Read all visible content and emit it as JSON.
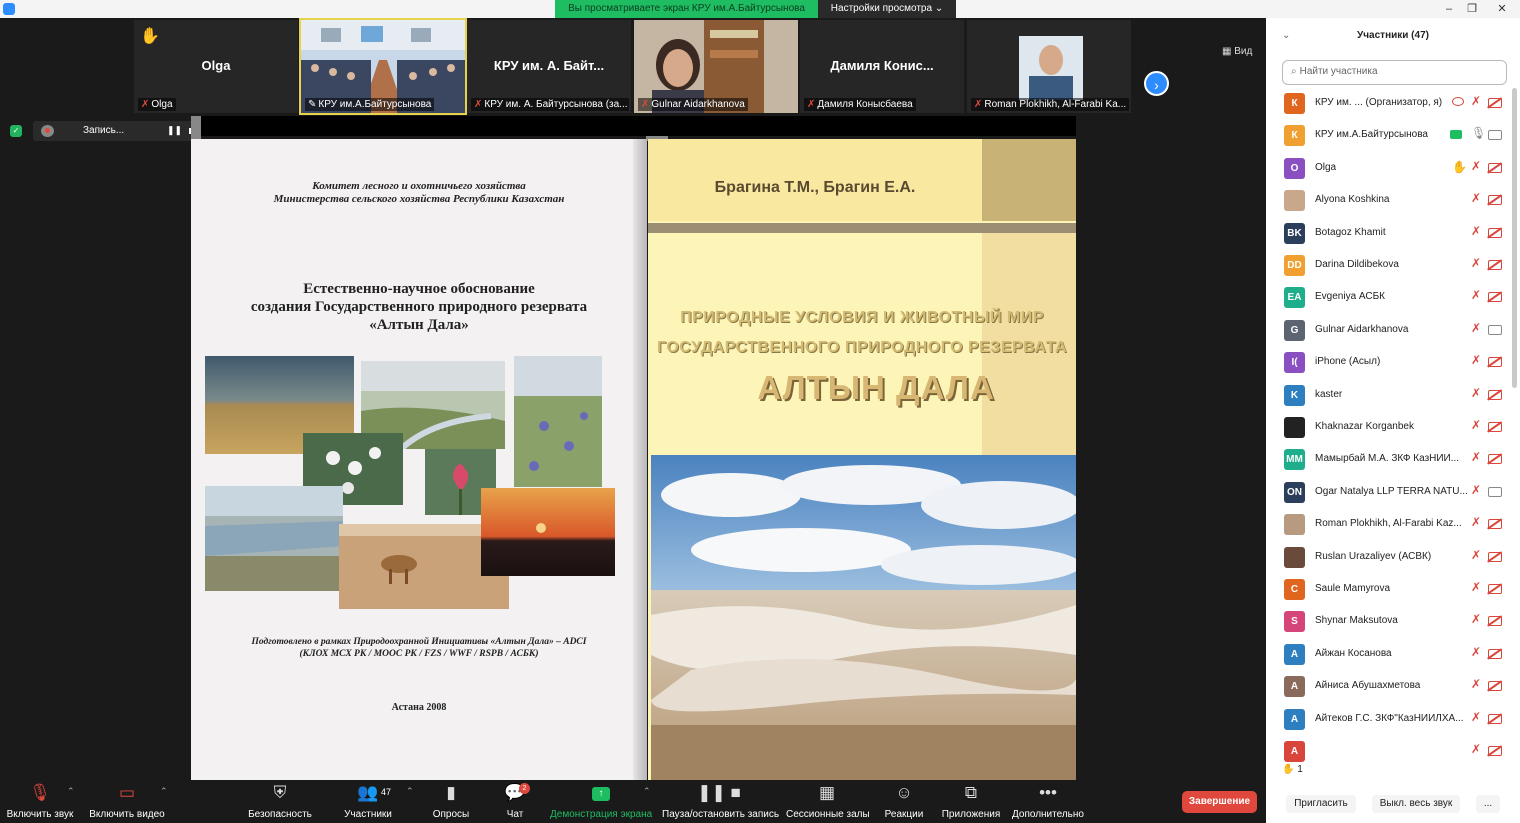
{
  "top_bar": {
    "share_banner": "Вы просматриваете экран КРУ им.А.Байтурсынова",
    "view_settings": "Настройки просмотра ⌄",
    "window_controls": {
      "minimize": "–",
      "restore": "❐",
      "close": "✕"
    }
  },
  "gallery": {
    "tiles": [
      {
        "name_center": "Olga",
        "label": "Olga",
        "icon": "hand-raised-icon"
      },
      {
        "name_center": "",
        "label": "КРУ им.А.Байтурсынова",
        "icon": "pin-icon"
      },
      {
        "name_center": "КРУ им. А. Байт...",
        "label": "КРУ им. А. Байтурсынова (за..."
      },
      {
        "name_center": "",
        "label": "Gulnar Aidarkhanova"
      },
      {
        "name_center": "Дамиля  Конис...",
        "label": "Дамиля Конысбаева"
      },
      {
        "name_center": "",
        "label": "Roman Plokhikh, Al-Farabi Ka..."
      }
    ],
    "next_page": "›",
    "view_button": "▦ Вид"
  },
  "recording": {
    "label": "Запись...",
    "pause": "❚❚"
  },
  "shared_screen": {
    "left_page": {
      "committee_line1": "Комитет лесного и охотничьего хозяйства",
      "committee_line2": "Министерства сельского хозяйства Республики Казахстан",
      "title_line1": "Естественно-научное обоснование",
      "title_line2": "создания Государственного природного резервата",
      "title_line3": "«Алтын Дала»",
      "note_line1": "Подготовлено в рамках Природоохранной Инициативы «Алтын Дала» – ADCI",
      "note_line2": "(КЛОХ МСХ РК / МООС РК / FZS / WWF / RSPB / АСБК)",
      "city": "Астана 2008"
    },
    "right_page": {
      "authors": "Брагина Т.М., Брагин Е.А.",
      "title_line1": "ПРИРОДНЫЕ  УСЛОВИЯ И  ЖИВОТНЫЙ  МИР",
      "title_line2": "ГОСУДАРСТВЕННОГО ПРИРОДНОГО  РЕЗЕРВАТА",
      "title_line3": "АЛТЫН ДАЛА"
    }
  },
  "participants_panel": {
    "title": "Участники (47)",
    "collapse_icon": "⌄",
    "search_placeholder": "Найти участника",
    "participants": [
      {
        "initials": "К",
        "color": "#e0661f",
        "name": "КРУ им. ...  (Организатор, я)",
        "mic": "muted",
        "cam": "off",
        "extra": "host"
      },
      {
        "initials": "К",
        "color": "#f0a030",
        "name": "КРУ им.А.Байтурсынова",
        "mic": "on",
        "cam": "on",
        "extra": "share"
      },
      {
        "initials": "O",
        "color": "#8a4fc0",
        "name": "Olga",
        "mic": "muted",
        "cam": "off",
        "extra": "hand"
      },
      {
        "initials": "",
        "color": "#c9a78a",
        "name": "Alyona Koshkina",
        "mic": "muted",
        "cam": "off",
        "extra": ""
      },
      {
        "initials": "BK",
        "color": "#2b3e5c",
        "name": "Botagoz Khamit",
        "mic": "muted",
        "cam": "off",
        "extra": ""
      },
      {
        "initials": "DD",
        "color": "#f0a030",
        "name": "Darina Dildibekova",
        "mic": "muted",
        "cam": "off",
        "extra": ""
      },
      {
        "initials": "EA",
        "color": "#1fae8c",
        "name": "Evgeniya АСБК",
        "mic": "muted",
        "cam": "off",
        "extra": ""
      },
      {
        "initials": "G",
        "color": "#5b6470",
        "name": "Gulnar Aidarkhanova",
        "mic": "muted",
        "cam": "on",
        "extra": ""
      },
      {
        "initials": "I(",
        "color": "#8a4fc0",
        "name": "iPhone (Асыл)",
        "mic": "muted",
        "cam": "off",
        "extra": ""
      },
      {
        "initials": "K",
        "color": "#2d7fc0",
        "name": "kaster",
        "mic": "muted",
        "cam": "off",
        "extra": ""
      },
      {
        "initials": "",
        "color": "#222222",
        "name": "Khaknazar Korganbek",
        "mic": "muted",
        "cam": "off",
        "extra": ""
      },
      {
        "initials": "MM",
        "color": "#1fae8c",
        "name": "Мамырбай М.А. ЗКФ КазНИИ...",
        "mic": "muted",
        "cam": "off",
        "extra": ""
      },
      {
        "initials": "ON",
        "color": "#2b3e5c",
        "name": "Ogar Natalya LLP TERRA NATU...",
        "mic": "muted",
        "cam": "on",
        "extra": ""
      },
      {
        "initials": "",
        "color": "#b89a80",
        "name": "Roman Plokhikh, Al-Farabi Kaz...",
        "mic": "muted",
        "cam": "off",
        "extra": ""
      },
      {
        "initials": "",
        "color": "#6a4a3a",
        "name": "Ruslan Urazaliyev (АСВК)",
        "mic": "muted",
        "cam": "off",
        "extra": ""
      },
      {
        "initials": "C",
        "color": "#e0661f",
        "name": "Saule Mamyrova",
        "mic": "muted",
        "cam": "off",
        "extra": ""
      },
      {
        "initials": "S",
        "color": "#d6457a",
        "name": "Shynar Maksutova",
        "mic": "muted",
        "cam": "off",
        "extra": ""
      },
      {
        "initials": "А",
        "color": "#2d7fc0",
        "name": "Айжан Косанова",
        "mic": "muted",
        "cam": "off",
        "extra": ""
      },
      {
        "initials": "А",
        "color": "#8a6a5a",
        "name": "Айниса Абушахметова",
        "mic": "muted",
        "cam": "off",
        "extra": ""
      },
      {
        "initials": "А",
        "color": "#2d7fc0",
        "name": "Айтеков Г.С. ЗКФ\"КазНИИЛХА...",
        "mic": "muted",
        "cam": "off",
        "extra": ""
      },
      {
        "initials": "А",
        "color": "#d9453b",
        "name": "",
        "mic": "muted",
        "cam": "off",
        "extra": ""
      }
    ],
    "raised_hands": "1",
    "invite": "Пригласить",
    "mute_all": "Выкл. весь звук",
    "more": "..."
  },
  "toolbar": {
    "unmute": "Включить звук",
    "start_video": "Включить видео",
    "security": "Безопасность",
    "participants": "Участники",
    "participants_count": "47",
    "polls": "Опросы",
    "chat": "Чат",
    "chat_badge": "2",
    "share_screen": "Демонстрация экрана",
    "pause_record": "Пауза/остановить запись",
    "breakout_rooms": "Сессионные залы",
    "reactions": "Реакции",
    "apps": "Приложения",
    "more": "Дополнительно",
    "end": "Завершение"
  }
}
